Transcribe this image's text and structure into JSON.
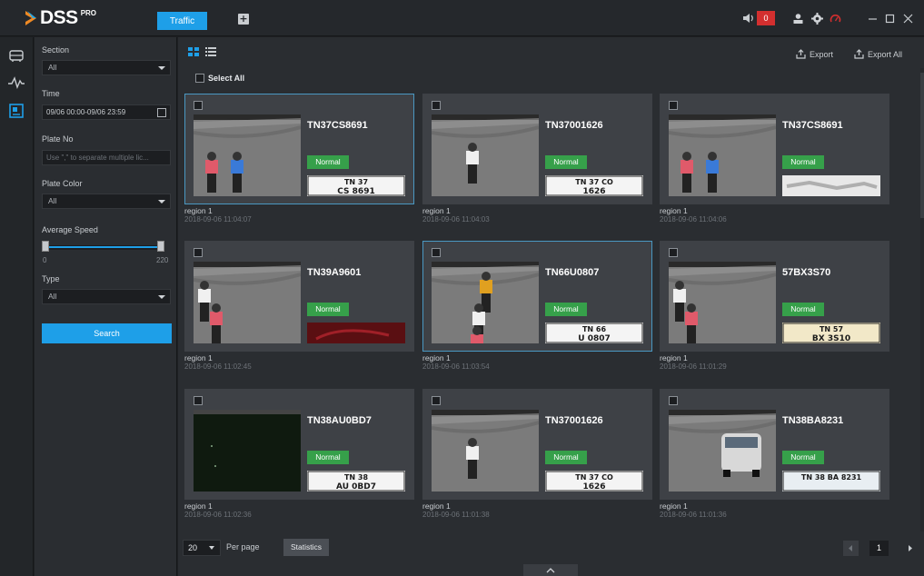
{
  "app": {
    "logo_text": "DSS",
    "logo_sup": "PRO",
    "active_tab": "Traffic",
    "alarm_count": "0"
  },
  "filter": {
    "section_label": "Section",
    "section_value": "All",
    "time_label": "Time",
    "time_value": "09/06 00:00-09/06 23:59",
    "plate_no_label": "Plate No",
    "plate_no_placeholder": "Use \",\" to separate multiple lic...",
    "plate_color_label": "Plate Color",
    "plate_color_value": "All",
    "speed_label": "Average Speed",
    "speed_min": "0",
    "speed_max": "220",
    "speed_range": [
      0,
      220
    ],
    "type_label": "Type",
    "type_value": "All",
    "search_label": "Search"
  },
  "toolbar": {
    "export_label": "Export",
    "export_all_label": "Export All",
    "select_all_label": "Select All"
  },
  "records": [
    {
      "plate": "TN37CS8691",
      "status": "Normal",
      "region": "region 1",
      "time": "2018-09-06 11:04:07",
      "selected": true,
      "plate_text": [
        "TN 37",
        "CS 8691"
      ]
    },
    {
      "plate": "TN37001626",
      "status": "Normal",
      "region": "region 1",
      "time": "2018-09-06 11:04:03",
      "selected": false,
      "plate_text": [
        "TN 37 CO",
        "1626"
      ]
    },
    {
      "plate": "TN37CS8691",
      "status": "Normal",
      "region": "region 1",
      "time": "2018-09-06 11:04:06",
      "selected": false,
      "plate_text": [
        "",
        ""
      ]
    },
    {
      "plate": "TN39A9601",
      "status": "Normal",
      "region": "region 1",
      "time": "2018-09-06 11:02:45",
      "selected": false,
      "plate_text": [
        "",
        ""
      ]
    },
    {
      "plate": "TN66U0807",
      "status": "Normal",
      "region": "region 1",
      "time": "2018-09-06 11:03:54",
      "selected": true,
      "plate_text": [
        "TN 66",
        "U 0807"
      ]
    },
    {
      "plate": "57BX3S70",
      "status": "Normal",
      "region": "region 1",
      "time": "2018-09-06 11:01:29",
      "selected": false,
      "plate_text": [
        "TN 57",
        "BX 3S10"
      ]
    },
    {
      "plate": "TN38AU0BD7",
      "status": "Normal",
      "region": "region 1",
      "time": "2018-09-06 11:02:36",
      "selected": false,
      "plate_text": [
        "TN 38",
        "AU 0BD7"
      ]
    },
    {
      "plate": "TN37001626",
      "status": "Normal",
      "region": "region 1",
      "time": "2018-09-06 11:01:38",
      "selected": false,
      "plate_text": [
        "TN 37 CO",
        "1626"
      ]
    },
    {
      "plate": "TN38BA8231",
      "status": "Normal",
      "region": "region 1",
      "time": "2018-09-06 11:01:36",
      "selected": false,
      "plate_text": [
        "TN 38 BA 8231",
        ""
      ]
    }
  ],
  "footer": {
    "per_page_value": "20",
    "per_page_label": "Per page",
    "statistics_label": "Statistics",
    "current_page": "1"
  },
  "colors": {
    "accent": "#1e9fe8",
    "status_normal": "#36a04a",
    "alarm": "#d32f2f"
  },
  "icons": [
    "sound-icon",
    "user-icon",
    "gear-icon",
    "gauge-icon",
    "minimize-icon",
    "maximize-icon",
    "close-icon",
    "car-nav-icon",
    "pulse-nav-icon",
    "gallery-nav-icon",
    "grid-view-icon",
    "list-view-icon",
    "export-icon",
    "calendar-icon"
  ]
}
